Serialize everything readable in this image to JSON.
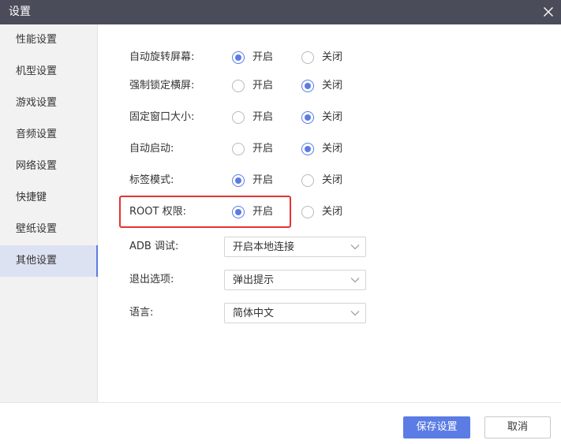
{
  "window": {
    "title": "设置",
    "close_icon": "close-icon"
  },
  "sidebar": {
    "items": [
      {
        "label": "性能设置"
      },
      {
        "label": "机型设置"
      },
      {
        "label": "游戏设置"
      },
      {
        "label": "音频设置"
      },
      {
        "label": "网络设置"
      },
      {
        "label": "快捷键"
      },
      {
        "label": "壁纸设置"
      },
      {
        "label": "其他设置"
      }
    ],
    "active": "其他设置"
  },
  "settings": {
    "on_label": "开启",
    "off_label": "关闭",
    "toggles": [
      {
        "label": "自动旋转屏幕:",
        "value": "on"
      },
      {
        "label": "强制锁定横屏:",
        "value": "off"
      },
      {
        "label": "固定窗口大小:",
        "value": "off"
      },
      {
        "label": "自动启动:",
        "value": "off"
      },
      {
        "label": "标签模式:",
        "value": "on"
      },
      {
        "label": "ROOT 权限:",
        "value": "on"
      }
    ],
    "selects": [
      {
        "label": "ADB 调试:",
        "value": "开启本地连接"
      },
      {
        "label": "退出选项:",
        "value": "弹出提示"
      },
      {
        "label": "语言:",
        "value": "简体中文"
      }
    ]
  },
  "footer": {
    "save_label": "保存设置",
    "cancel_label": "取消"
  },
  "colors": {
    "accent": "#5b7ce4",
    "titlebar": "#4a4c5a",
    "highlight": "#e53333",
    "sidebar_bg": "#f2f2f2",
    "sidebar_active": "#dde2f3"
  }
}
